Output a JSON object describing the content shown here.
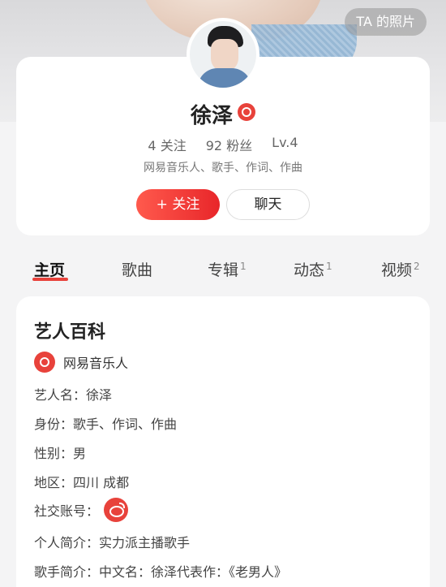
{
  "header": {
    "photo_button": "TA 的照片"
  },
  "profile": {
    "name": "徐泽",
    "following": "4 关注",
    "followers": "92 粉丝",
    "level": "Lv.4",
    "tags": "网易音乐人、歌手、作词、作曲",
    "follow_button": "+ 关注",
    "chat_button": "聊天"
  },
  "tabs": [
    {
      "label": "主页",
      "count": ""
    },
    {
      "label": "歌曲",
      "count": ""
    },
    {
      "label": "专辑",
      "count": "1"
    },
    {
      "label": "动态",
      "count": "1"
    },
    {
      "label": "视频",
      "count": "2"
    }
  ],
  "wiki": {
    "title": "艺人百科",
    "source": "网易音乐人",
    "rows": [
      "艺人名：徐泽",
      "身份：歌手、作词、作曲",
      "性别：男",
      "地区：四川 成都",
      "社交账号：",
      "个人简介：实力派主播歌手",
      "歌手简介：中文名：徐泽代表作：《老男人》"
    ]
  },
  "colors": {
    "accent": "#e8423b",
    "background": "#f4f4f5"
  }
}
